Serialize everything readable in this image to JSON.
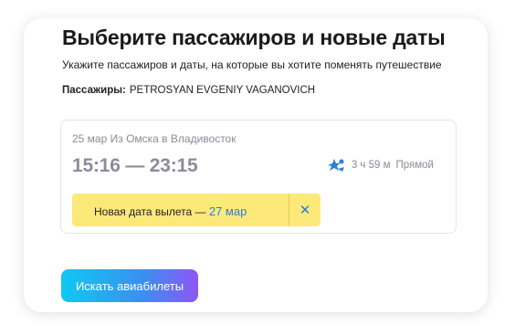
{
  "page": {
    "title": "Выберите пассажиров и новые даты",
    "subtitle": "Укажите пассажиров и даты, на которые вы хотите поменять путешествие"
  },
  "passengers": {
    "label": "Пассажиры:",
    "names": "PETROSYAN EVGENIY VAGANOVICH"
  },
  "flight": {
    "route": "25 мар Из Омска в Владивосток",
    "times": "15:16 — 23:15",
    "airline_icon": "airline-logo-icon",
    "duration": "3 ч 59 м",
    "type": "Прямой",
    "new_date_label": "Новая дата вылета —",
    "new_date_value": "27 мар",
    "close_symbol": "✕"
  },
  "actions": {
    "search_label": "Искать авиабилеты"
  },
  "colors": {
    "banner": "#fde97a",
    "link": "#2f7bd9",
    "button_gradient_start": "#10c8f2",
    "button_gradient_end": "#8f56f5"
  }
}
